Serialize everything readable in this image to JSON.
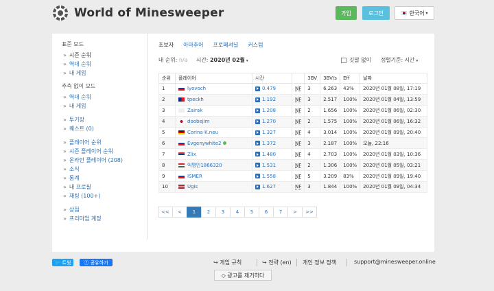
{
  "header": {
    "title": "World of Minesweeper",
    "join_label": "가입",
    "login_label": "로그인",
    "language_label": "한국어"
  },
  "sidebar": {
    "section_standard": "표준 모드",
    "standard_items": [
      {
        "label": "시즌 순위"
      },
      {
        "label": "역대 순위"
      },
      {
        "label": "내 게임"
      }
    ],
    "section_noguess": "추측 없이 모드",
    "noguess_items": [
      {
        "label": "역대 순위"
      },
      {
        "label": "내 게임"
      }
    ],
    "misc_items": [
      {
        "label": "투기장"
      },
      {
        "label": "퀘스트 (0)"
      }
    ],
    "player_items": [
      {
        "label": "플레이어 순위"
      },
      {
        "label": "시즌 플레이어 순위"
      },
      {
        "label": "온라인 플레이어 (208)"
      },
      {
        "label": "소식"
      },
      {
        "label": "통계"
      },
      {
        "label": "내 프로필"
      },
      {
        "label": "채팅 (100+)"
      }
    ],
    "shop_items": [
      {
        "label": "상점"
      },
      {
        "label": "프리미엄 계정"
      }
    ]
  },
  "tabs": [
    "초보자",
    "아마추어",
    "프로페셔널",
    "커스텀"
  ],
  "filters": {
    "my_place_label": "내 순위:",
    "my_place_value": "n/a",
    "time_label": "시간:",
    "time_value": "2020년 02월",
    "no_flags_label": "깃발 없이",
    "sort_label": "정렬기준: 시간"
  },
  "table": {
    "headers": [
      "순위",
      "플레이어",
      "시간",
      "",
      "3BV",
      "3BV/s",
      "Eff",
      "날짜"
    ],
    "rows": [
      {
        "rank": "1",
        "player": "lyovoch",
        "flag": "ru",
        "time": "0.479",
        "nf": "NF",
        "bv": "3",
        "bvs": "6.263",
        "eff": "43%",
        "date": "2020년 01월 08일, 17:19"
      },
      {
        "rank": "2",
        "player": "tpeckh",
        "flag": "tw",
        "time": "1.192",
        "nf": "NF",
        "bv": "3",
        "bvs": "2.517",
        "eff": "100%",
        "date": "2020년 01월 04일, 13:59"
      },
      {
        "rank": "3",
        "player": "Zairak",
        "flag": "other",
        "time": "1.208",
        "nf": "NF",
        "bv": "2",
        "bvs": "1.656",
        "eff": "100%",
        "date": "2020년 01월 06일, 02:30"
      },
      {
        "rank": "4",
        "player": "doobejim",
        "flag": "kr",
        "time": "1.270",
        "nf": "NF",
        "bv": "2",
        "bvs": "1.575",
        "eff": "100%",
        "date": "2020년 01월 06일, 16:32"
      },
      {
        "rank": "5",
        "player": "Corina K.neu",
        "flag": "de",
        "time": "1.327",
        "nf": "NF",
        "bv": "4",
        "bvs": "3.014",
        "eff": "100%",
        "date": "2020년 01월 09일, 20:40"
      },
      {
        "rank": "6",
        "player": "Evgenywhite2",
        "flag": "ru",
        "online": true,
        "time": "1.372",
        "nf": "NF",
        "bv": "3",
        "bvs": "2.187",
        "eff": "100%",
        "date": "오늘, 22:16"
      },
      {
        "rank": "7",
        "player": "Zlix",
        "flag": "rs",
        "time": "1.480",
        "nf": "NF",
        "bv": "4",
        "bvs": "2.703",
        "eff": "100%",
        "date": "2020년 01월 03일, 10:36"
      },
      {
        "rank": "8",
        "player": "익명인1866320",
        "flag": "hu",
        "time": "1.531",
        "nf": "NF",
        "bv": "2",
        "bvs": "1.306",
        "eff": "100%",
        "date": "2020년 01월 05일, 03:21"
      },
      {
        "rank": "9",
        "player": "ISMER",
        "flag": "ru",
        "time": "1.558",
        "nf": "NF",
        "bv": "5",
        "bvs": "3.209",
        "eff": "83%",
        "date": "2020년 01월 09일, 19:40"
      },
      {
        "rank": "10",
        "player": "Ugis",
        "flag": "lv",
        "time": "1.627",
        "nf": "NF",
        "bv": "3",
        "bvs": "1.844",
        "eff": "100%",
        "date": "2020년 01월 09일, 04:34"
      }
    ]
  },
  "pagination": [
    "<<",
    "<",
    "1",
    "2",
    "3",
    "4",
    "5",
    "6",
    "7",
    ">",
    ">>"
  ],
  "footer": {
    "tweet_label": "트윗",
    "share_label": "공유하기",
    "rules_label": "게임 규칙",
    "strategy_label": "전략 (en)",
    "privacy_label": "개인 정보 정책",
    "email": "support@minesweeper.online",
    "remove_ads_label": "광고를 제거하다"
  }
}
